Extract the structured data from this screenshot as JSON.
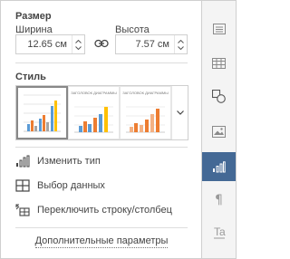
{
  "size": {
    "title": "Размер",
    "width_label": "Ширина",
    "height_label": "Высота",
    "width_value": "12.65 см",
    "height_value": "7.57 см"
  },
  "style": {
    "title": "Стиль",
    "thumbnails": [
      {
        "title": "",
        "selected": true
      },
      {
        "title": "ЗАГОЛОВОК ДИАГРАММЫ",
        "selected": false
      },
      {
        "title": "ЗАГОЛОВОК ДИАГРАММЫ",
        "selected": false
      }
    ]
  },
  "actions": {
    "change_type": "Изменить тип",
    "select_data": "Выбор данных",
    "switch_row_col": "Переключить строку/столбец"
  },
  "advanced": "Дополнительные параметры",
  "rightbar": {
    "items": [
      {
        "icon": "paragraph-settings-icon",
        "active": false
      },
      {
        "icon": "table-settings-icon",
        "active": false
      },
      {
        "icon": "shape-settings-icon",
        "active": false
      },
      {
        "icon": "image-settings-icon",
        "active": false
      },
      {
        "icon": "chart-settings-icon",
        "active": true
      },
      {
        "icon": "paragraph-mark-icon",
        "active": false
      },
      {
        "icon": "text-art-icon",
        "active": false
      }
    ],
    "accent": "#446995"
  }
}
